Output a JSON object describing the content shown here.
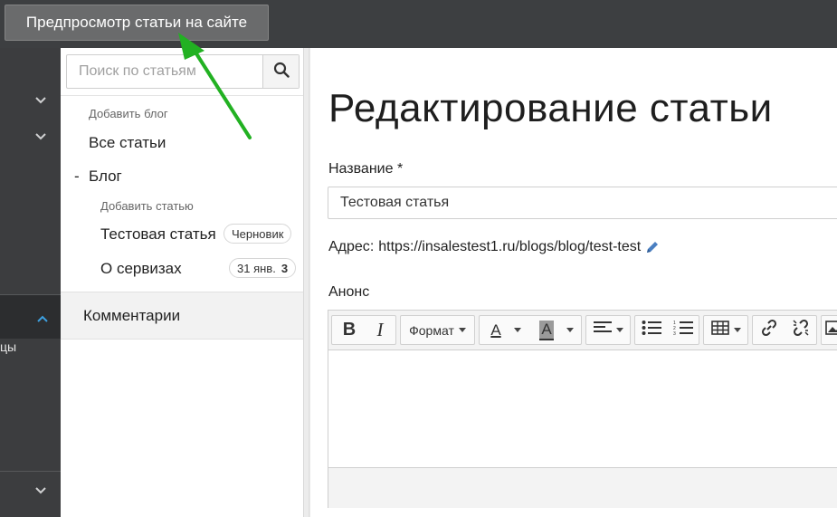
{
  "topbar": {
    "preview_label": "Предпросмотр статьи на сайте"
  },
  "left_nav": {
    "partial_text": "цы"
  },
  "search": {
    "placeholder": "Поиск по статьям"
  },
  "tree": {
    "add_blog": "Добавить блог",
    "all_articles": "Все статьи",
    "blog_toggle": "-",
    "blog_label": "Блог",
    "add_article": "Добавить статью",
    "articles": [
      {
        "title": "Тестовая статья",
        "badge": "Черновик",
        "count": ""
      },
      {
        "title": "О сервизах",
        "badge": "31 янв.",
        "count": "3"
      }
    ]
  },
  "comments": {
    "label": "Комментарии"
  },
  "main": {
    "page_title": "Редактирование статьи",
    "name_label": "Название *",
    "name_value": "Тестовая статья",
    "address_label": "Адрес",
    "address_url": "https://insalestest1.ru/blogs/blog/test-test",
    "announce_label": "Анонс"
  },
  "toolbar": {
    "format_label": "Формат",
    "bold_glyph": "B",
    "italic_glyph": "I",
    "text_color_glyph": "A",
    "bg_color_glyph": "A"
  },
  "colors": {
    "topbar": "#3d3f41",
    "arrow": "#22b122",
    "nav": "#3c3d3f",
    "edit_icon": "#4a7fc1"
  },
  "icons": [
    "search-icon",
    "chevron-down-icon",
    "chevron-up-icon",
    "pencil-icon",
    "align-left-icon",
    "bullet-list-icon",
    "numbered-list-icon",
    "table-icon",
    "link-icon",
    "unlink-icon",
    "image-icon",
    "annotation-arrow"
  ]
}
